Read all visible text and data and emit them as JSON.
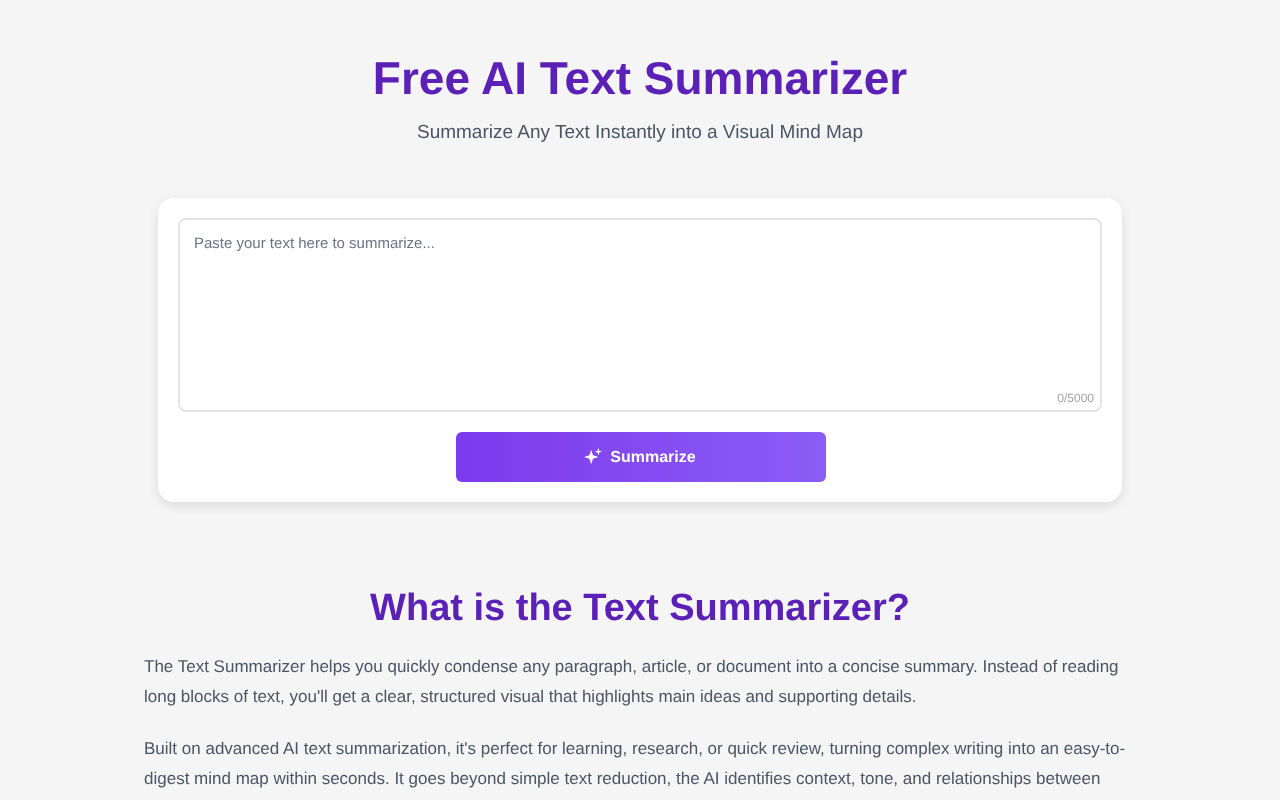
{
  "header": {
    "title": "Free AI Text Summarizer",
    "subtitle": "Summarize Any Text Instantly into a Visual Mind Map"
  },
  "input": {
    "placeholder": "Paste your text here to summarize...",
    "counter": "0/5000"
  },
  "button": {
    "label": "Summarize"
  },
  "about": {
    "heading": "What is the Text Summarizer?",
    "paragraphs": [
      "The Text Summarizer helps you quickly condense any paragraph, article, or document into a concise summary. Instead of reading long blocks of text, you'll get a clear, structured visual that highlights main ideas and supporting details.",
      "Built on advanced AI text summarization, it's perfect for learning, research, or quick review, turning complex writing into an easy-to-digest mind map within seconds. It goes beyond simple text reduction, the AI identifies context, tone, and relationships between"
    ]
  }
}
